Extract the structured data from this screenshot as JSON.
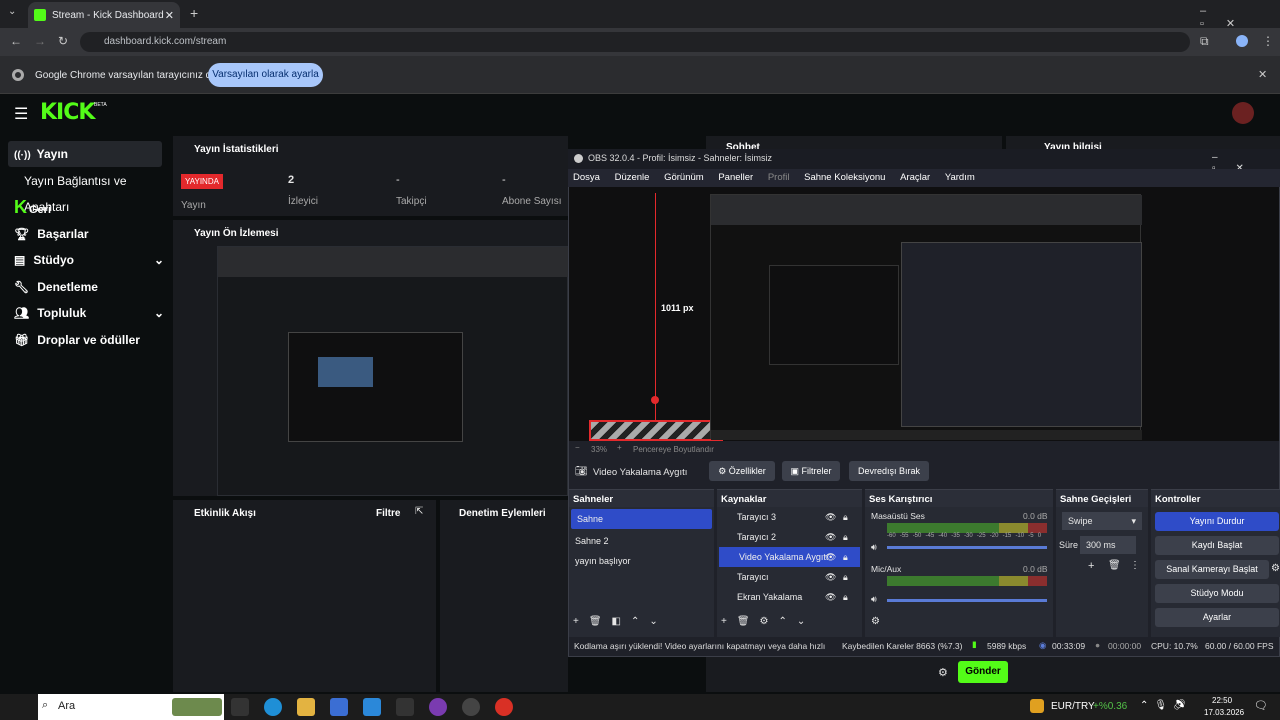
{
  "browser": {
    "tab_title": "Stream - Kick Dashboard",
    "url": "dashboard.kick.com/stream",
    "infobar_text": "Google Chrome varsayılan tarayıcınız değil",
    "infobar_button": "Varsayılan olarak ayarla"
  },
  "kick": {
    "logo": "KICK",
    "logo_badge": "BETA",
    "sidebar": [
      {
        "label": "Yayın",
        "icon": "broadcast-icon"
      },
      {
        "label": "Yayın Bağlantısı ve Anahtarı"
      },
      {
        "label": "Geri"
      },
      {
        "label": "Başarılar",
        "icon": "trophy-icon"
      },
      {
        "label": "Stüdyo",
        "icon": "studio-icon"
      },
      {
        "label": "Denetleme",
        "icon": "wrench-icon"
      },
      {
        "label": "Topluluk",
        "icon": "community-icon"
      },
      {
        "label": "Droplar ve ödüller",
        "icon": "gift-icon"
      }
    ],
    "stats": {
      "title": "Yayın İstatistikleri",
      "live_badge": "YAYINDA",
      "items": [
        {
          "value": "",
          "label": "Yayın"
        },
        {
          "value": "2",
          "label": "İzleyici"
        },
        {
          "value": "-",
          "label": "Takipçi"
        },
        {
          "value": "-",
          "label": "Abone Sayısı"
        }
      ]
    },
    "chat_title": "Sohbet",
    "info_title": "Yayın bilgisi",
    "preview_title": "Yayın Ön İzlemesi",
    "activity_title": "Etkinlik Akışı",
    "activity_filter": "Filtre",
    "moderation_title": "Denetim Eylemleri",
    "send_button": "Gönder"
  },
  "obs": {
    "title": "OBS 32.0.4 - Profil: İsimsiz - Sahneler: İsimsiz",
    "menu": [
      "Dosya",
      "Düzenle",
      "Görünüm",
      "Paneller",
      "Profil",
      "Sahne Koleksiyonu",
      "Araçlar",
      "Yardım"
    ],
    "measure": "1011 px",
    "zoom": "33%",
    "zoom_fit": "Pencereye Boyutlandır",
    "source_bar": {
      "name": "Video Yakalama Aygıtı",
      "properties": "Özellikler",
      "filters": "Filtreler",
      "deactivate": "Devredışı Bırak"
    },
    "scenes": {
      "title": "Sahneler",
      "items": [
        "Sahne",
        "Sahne 2",
        "yayın başlıyor"
      ]
    },
    "sources": {
      "title": "Kaynaklar",
      "items": [
        "Tarayıcı 3",
        "Tarayıcı 2",
        "Video Yakalama Aygıtı",
        "Tarayıcı",
        "Ekran Yakalama"
      ]
    },
    "mixer": {
      "title": "Ses Karıştırıcı",
      "channels": [
        {
          "name": "Masaüstü Ses",
          "db": "0.0 dB"
        },
        {
          "name": "Mic/Aux",
          "db": "0.0 dB"
        }
      ],
      "scale": [
        "-60",
        "-55",
        "-50",
        "-45",
        "-40",
        "-35",
        "-30",
        "-25",
        "-20",
        "-15",
        "-10",
        "-5",
        "0"
      ]
    },
    "transitions": {
      "title": "Sahne Geçişleri",
      "type": "Swipe",
      "duration_label": "Süre",
      "duration": "300 ms"
    },
    "controls": {
      "title": "Kontroller",
      "buttons": [
        "Yayını Durdur",
        "Kaydı Başlat",
        "Sanal Kamerayı Başlat",
        "Stüdyo Modu",
        "Ayarlar"
      ]
    },
    "status": {
      "warning": "Kodlama aşırı yüklendi! Video ayarlarını kapatmayı veya daha hızlı",
      "dropped": "Kaybedilen Kareler 8663 (%7.3)",
      "bitrate": "5989 kbps",
      "live_time": "00:33:09",
      "rec_time": "00:00:00",
      "cpu": "CPU: 10.7%",
      "fps": "60.00 / 60.00 FPS"
    }
  },
  "taskbar": {
    "search": "Ara",
    "currency": "EUR/TRY",
    "currency_change": "+%0.36",
    "time": "22:50",
    "date": "17.03.2026"
  },
  "colors": {
    "kick_green": "#53fc18",
    "live_red": "#e4292c",
    "obs_selected": "#2f4cc8"
  }
}
